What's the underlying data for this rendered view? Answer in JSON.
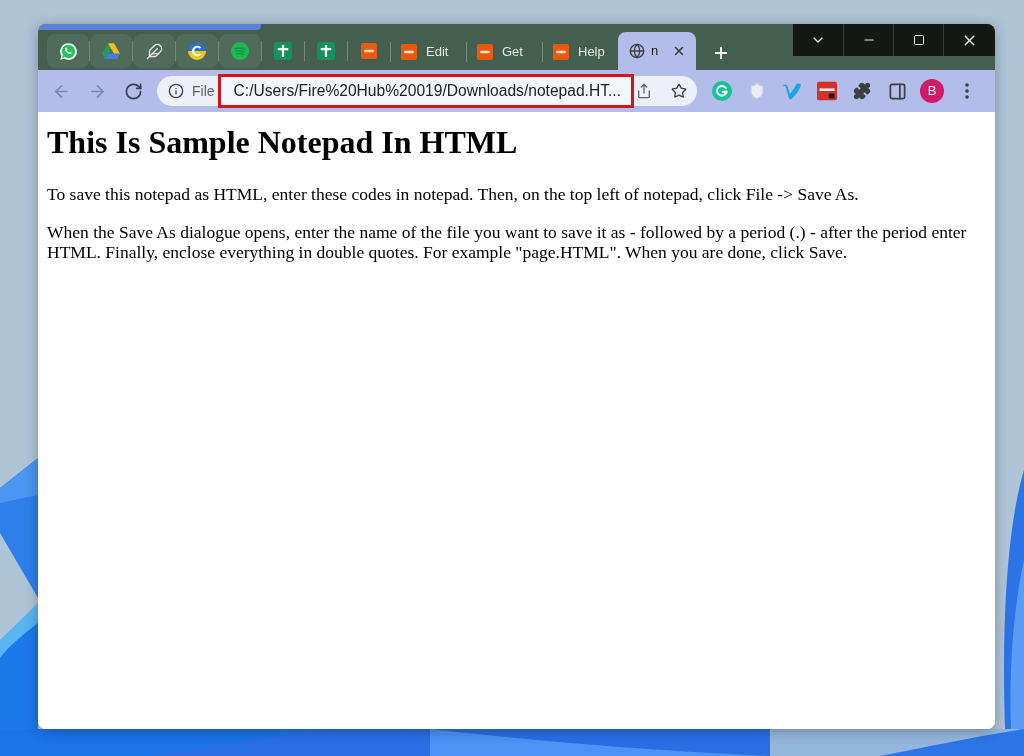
{
  "pinned_tabs": [
    {
      "grouped": true,
      "selected": false
    },
    {
      "grouped": true,
      "selected": false
    },
    {
      "grouped": true,
      "selected": false
    },
    {
      "grouped": true,
      "selected": false
    },
    {
      "grouped": true,
      "selected": false
    },
    {
      "grouped": false,
      "selected": false
    },
    {
      "grouped": false,
      "selected": false
    },
    {
      "grouped": false,
      "selected": false
    }
  ],
  "tabs": [
    {
      "title": "Edit",
      "selected": false
    },
    {
      "title": "Get",
      "selected": false
    },
    {
      "title": "Help",
      "selected": false
    },
    {
      "title": "n",
      "selected": true
    }
  ],
  "nav_buttons": [
    {
      "disabled": true
    },
    {
      "disabled": true
    },
    {
      "disabled": false
    }
  ],
  "address_bar": {
    "scheme": "File",
    "url": "C:/Users/Fire%20Hub%20019/Downloads/notepad.HT...",
    "highlighted": true
  },
  "profile": {
    "initial": "B"
  },
  "page": {
    "heading": "This Is Sample Notepad In HTML",
    "paragraphs": [
      "To save this notepad as HTML, enter these codes in notepad. Then, on the top left of notepad, click File -> Save As.",
      "When the Save As dialogue opens, enter the name of the file you want to save it as - followed by a period (.) - after the period enter HTML. Finally, enclose everything in double quotes. For example \"page.HTML\". When you are done, click Save."
    ]
  }
}
